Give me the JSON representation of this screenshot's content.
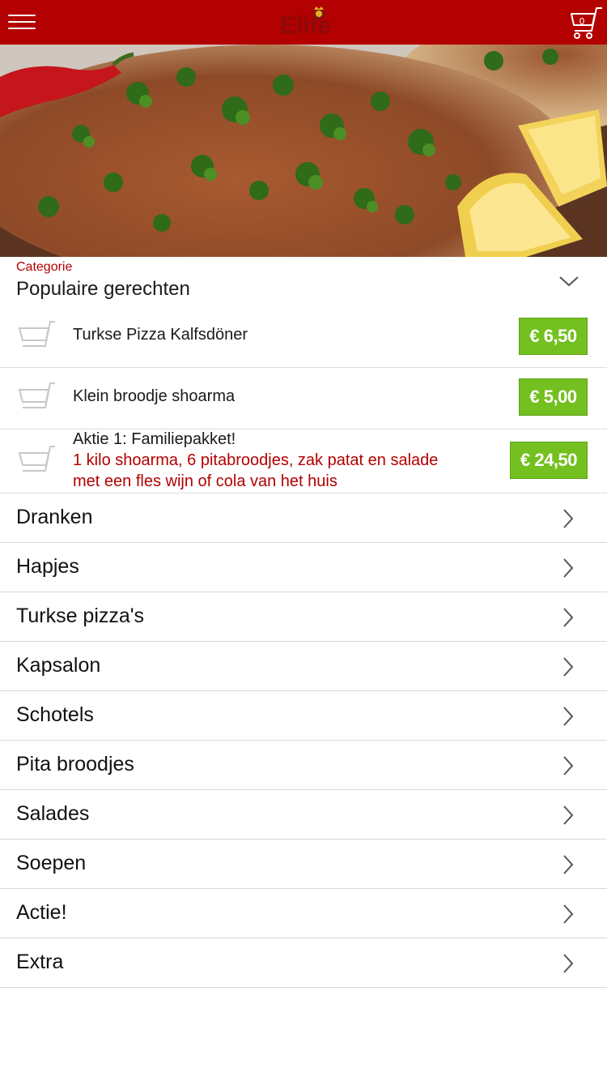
{
  "header": {
    "logo_text": "Elite",
    "cart_count": "0",
    "brand_color": "#b30000"
  },
  "hero": {
    "description_icon": "food-photo"
  },
  "category_selector": {
    "caption": "Categorie",
    "selected": "Populaire gerechten"
  },
  "popular": [
    {
      "name": "Turkse Pizza Kalfsdöner",
      "description": "",
      "price": "€ 6,50"
    },
    {
      "name": "Klein broodje shoarma",
      "description": "",
      "price": "€ 5,00"
    },
    {
      "name": "Aktie 1: Familiepakket!",
      "description_line1": "1 kilo shoarma, 6 pitabroodjes, zak patat en salade",
      "description_line2": "met een fles wijn of cola van het huis",
      "price": "€ 24,50"
    }
  ],
  "categories": [
    {
      "label": "Dranken"
    },
    {
      "label": "Hapjes"
    },
    {
      "label": "Turkse pizza's"
    },
    {
      "label": "Kapsalon"
    },
    {
      "label": "Schotels"
    },
    {
      "label": "Pita broodjes"
    },
    {
      "label": "Salades"
    },
    {
      "label": "Soepen"
    },
    {
      "label": "Actie!"
    },
    {
      "label": "Extra"
    }
  ],
  "colors": {
    "accent_red": "#b30000",
    "price_green": "#74c020"
  }
}
